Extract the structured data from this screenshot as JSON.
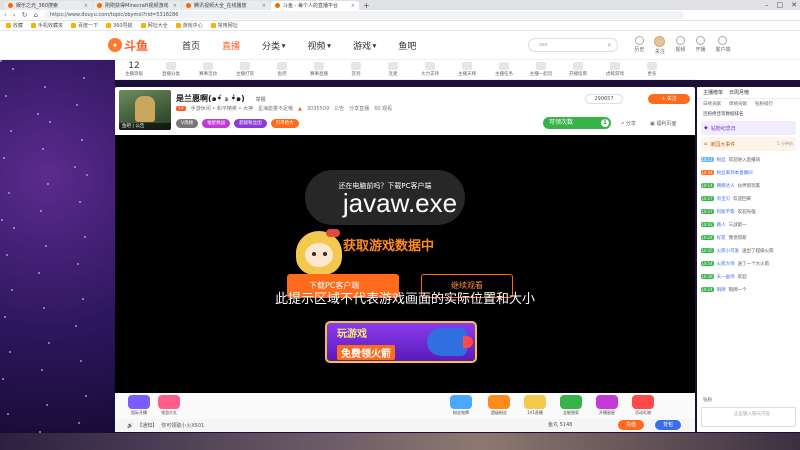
{
  "browser": {
    "tabs": [
      {
        "label": "娱乐之光_360搜索",
        "active": false
      },
      {
        "label": "刚刚获得Minecraft视频游戏",
        "active": false
      },
      {
        "label": "腾讯视频大全_在线播放",
        "active": false
      },
      {
        "label": "斗鱼 - 每个人的直播平台",
        "active": true
      }
    ],
    "url": "https://www.douyu.com/topic/zbymxl?rid=5318286",
    "bookmarks": [
      "收藏",
      "手机收藏夹",
      "百度一下",
      "360导航",
      "网址大全",
      "游戏中心",
      "常用网址"
    ]
  },
  "header": {
    "logo": "斗鱼",
    "nav": [
      {
        "label": "首页",
        "active": false,
        "caret": false
      },
      {
        "label": "直播",
        "active": true,
        "caret": false
      },
      {
        "label": "分类",
        "active": false,
        "caret": true
      },
      {
        "label": "视频",
        "active": false,
        "caret": true
      },
      {
        "label": "游戏",
        "active": false,
        "caret": true
      },
      {
        "label": "鱼吧",
        "active": false,
        "caret": false
      }
    ],
    "search_placeholder": "sss",
    "icons": [
      {
        "name": "history-icon",
        "label": "历史"
      },
      {
        "name": "follow-icon",
        "label": "关注"
      },
      {
        "name": "video-icon",
        "label": "视频"
      },
      {
        "name": "upload-icon",
        "label": "开播"
      },
      {
        "name": "client-icon",
        "label": "客户端"
      }
    ]
  },
  "categories": [
    {
      "label": "主播等级",
      "num": "12"
    },
    {
      "label": "直播分类",
      "num": ""
    },
    {
      "label": "赛事活动",
      "num": ""
    },
    {
      "label": "主播打赏",
      "num": ""
    },
    {
      "label": "鱼吧",
      "num": ""
    },
    {
      "label": "赛事直播",
      "num": ""
    },
    {
      "label": "签到",
      "num": ""
    },
    {
      "label": "连麦",
      "num": ""
    },
    {
      "label": "大力支持",
      "num": ""
    },
    {
      "label": "主播天梯",
      "num": ""
    },
    {
      "label": "主播任务",
      "num": ""
    },
    {
      "label": "主播一起玩",
      "num": ""
    },
    {
      "label": "开播指南",
      "num": ""
    },
    {
      "label": "虎鲸游戏",
      "num": ""
    },
    {
      "label": "更多",
      "num": ""
    }
  ],
  "room": {
    "avatar_caption": "鱼吧 | 公告",
    "title": "是兰惠啊(๑•́ ₃ •̀๑)",
    "title_sub": "举报",
    "meta": {
      "level": "12",
      "tags": "手游休闲 • 和平精英 • 大神",
      "game": "星海能量不足哦",
      "heat": "3035509",
      "notice": "公告",
      "extra": "分享直播",
      "fans": "60 观看"
    },
    "tags": [
      {
        "label": "V周榜",
        "style": "a"
      },
      {
        "label": "福星挑战",
        "style": "b"
      },
      {
        "label": "超级粉丝团",
        "style": "c"
      },
      {
        "label": "贝币抢大",
        "style": "d"
      }
    ],
    "hot": "290657",
    "follow": "关注",
    "claim": {
      "label": "可领次数",
      "count": "1"
    },
    "share": "分享",
    "report": "福利页面"
  },
  "video": {
    "cloud_text": "还在电脑前吗？下载PC客户端",
    "title": "javaw.exe",
    "loading": "获取游戏数据中",
    "btn_pc": "下载PC客户端",
    "btn_watch": "继续观看",
    "caption": "此提示区域不代表游戏画面的实际位置和大小",
    "play_line1": "玩游戏",
    "play_line2": "免费领火箭"
  },
  "gifts": [
    {
      "label": "国际开播",
      "color": "#7b5cff"
    },
    {
      "label": "领游大礼",
      "color": "#ff5d8a"
    },
    {
      "label": "粉丝铭牌",
      "color": "#4aa8ff"
    },
    {
      "label": "超级粉丝",
      "color": "#ff8a1c"
    },
    {
      "label": "1V1直播",
      "color": "#f2c94c"
    },
    {
      "label": "全能独家",
      "color": "#38b34a"
    },
    {
      "label": "开播星星",
      "color": "#c23ad6"
    },
    {
      "label": "活动礼物",
      "color": "#ff4a4a"
    }
  ],
  "notice": {
    "prefix": "【通知】",
    "text": "你可领取小火X501"
  },
  "wallet": {
    "fishball": "鱼丸 5148",
    "recharge": "充值",
    "backpack": "背包"
  },
  "chat": {
    "tabs": [
      "主播榜单",
      "日周月榜"
    ],
    "subtabs": [
      "日榜贡献",
      "周榜贡献",
      "钻粉排行"
    ],
    "rank_row": "连粉绝佳等数据排名",
    "event1": "钻粉纪念日",
    "event2": "家园大事件",
    "event2_time": "5 分钟前",
    "messages": [
      {
        "lv": "LV:11",
        "lvcolor": "#6bb4ff",
        "name": "粉丝",
        "text": "欢迎进入直播间"
      },
      {
        "lv": "LV:34",
        "lvcolor": "#ff6a1c",
        "name": "粉丝来到本直播间",
        "text": ""
      },
      {
        "lv": "LV:14",
        "lvcolor": "#38b34a",
        "name": "网络达人",
        "text": "伙伴新玩家"
      },
      {
        "lv": "LV:27",
        "lvcolor": "#38b34a",
        "name": "有宝贝",
        "text": "欢迎回来"
      },
      {
        "lv": "LV:37",
        "lvcolor": "#38b34a",
        "name": "阿能不客",
        "text": "欢迎光临"
      },
      {
        "lv": "LV:42",
        "lvcolor": "#38b34a",
        "name": "路人",
        "text": "三战第一"
      },
      {
        "lv": "LV:24",
        "lvcolor": "#38b34a",
        "name": "好友",
        "text": "我觉得新"
      },
      {
        "lv": "LV:35",
        "lvcolor": "#38b34a",
        "name": "火箭小可爱",
        "text": "送出了超级火箭"
      },
      {
        "lv": "LV:54",
        "lvcolor": "#38b34a",
        "name": "火箭大师",
        "text": "送了一个大火箭"
      },
      {
        "lv": "LV:38",
        "lvcolor": "#38b34a",
        "name": "天一画师",
        "text": "欢迎"
      },
      {
        "lv": "LV:24",
        "lvcolor": "#38b34a",
        "name": "铜牌",
        "text": "铜牌一个"
      }
    ],
    "gifts_label": "钻粉",
    "input_placeholder": "这里输入聊天内容"
  }
}
